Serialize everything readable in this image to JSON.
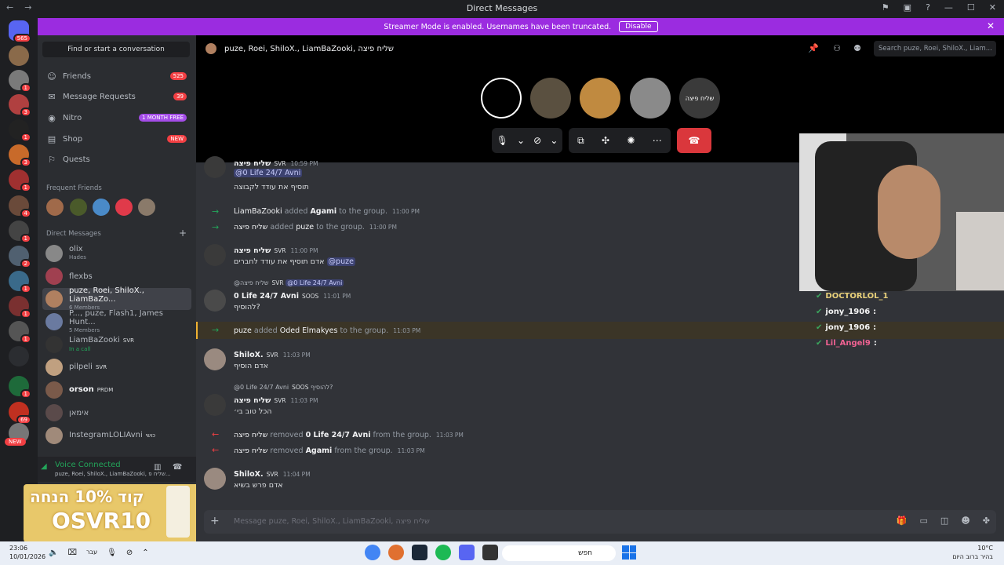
{
  "window": {
    "title": "Direct Messages"
  },
  "banner": {
    "text": "Streamer Mode is enabled. Usernames have been truncated.",
    "button": "Disable"
  },
  "servers": {
    "home_badge": "565",
    "new_label": "NEW"
  },
  "sidebar": {
    "find": "Find or start a conversation",
    "nav": [
      {
        "label": "Friends",
        "badge": "525"
      },
      {
        "label": "Message Requests",
        "badge": "39"
      },
      {
        "label": "Nitro",
        "badge": "1 MONTH FREE"
      },
      {
        "label": "Shop",
        "badge": "NEW"
      },
      {
        "label": "Quests",
        "badge": ""
      }
    ],
    "frequent_title": "Frequent Friends",
    "dm_title": "Direct Messages",
    "dms": [
      {
        "name": "olix",
        "sub": "Hades",
        "tag": ""
      },
      {
        "name": "flexbs",
        "sub": "",
        "tag": ""
      },
      {
        "name": "puze, Roei, ShiloX., LiamBaZo...",
        "sub": "6 Members",
        "tag": ""
      },
      {
        "name": "P..., puze, Flash1, James Hunt...",
        "sub": "5 Members",
        "tag": ""
      },
      {
        "name": "LiamBaZooki",
        "sub": "In a call",
        "tag": "SVR"
      },
      {
        "name": "pilpeli",
        "sub": "",
        "tag": "SVR"
      },
      {
        "name": "orson",
        "sub": "",
        "tag": "PRDM"
      },
      {
        "name": "אימאן",
        "sub": "",
        "tag": ""
      },
      {
        "name": "InstegramLOLIAvni",
        "sub": "",
        "tag": "כושי"
      }
    ],
    "voice": {
      "status": "Voice Connected",
      "channel": "puze, Roei, ShiloX., LiamBaZooki, שליח פ..."
    },
    "promo": {
      "line1": "קוד 10% הנחה",
      "line2": "OSVR10"
    }
  },
  "channel": {
    "title": "puze, Roei, ShiloX., LiamBaZooki, שליח פיצה",
    "search_placeholder": "Search puze, Roei, ShiloX., Liam..."
  },
  "call": {
    "badge": "שליח פיצה"
  },
  "messages": {
    "m1": {
      "author": "שליח פיצה",
      "tag": "SVR",
      "time": "10:59 PM",
      "mention": "@0 Life 24/7 Avni",
      "text": "תוסיף את עודד לקבוצה"
    },
    "s1": {
      "actor": "LiamBaZooki",
      "verb": "added",
      "target": "Agami",
      "rest": "to the group.",
      "time": "11:00 PM"
    },
    "s2": {
      "actor": "שליח פיצה",
      "verb": "added",
      "target": "puze",
      "rest": "to the group.",
      "time": "11:00 PM"
    },
    "m2": {
      "author": "שליח פיצה",
      "tag": "SVR",
      "time": "11:00 PM",
      "text": "אדם תוסיף את עודד לחברים",
      "mention": "@puze"
    },
    "m3": {
      "reply_author": "@שליח פיצה",
      "reply_tag": "SVR",
      "reply_mention": "@0 Life 24/7 Avni",
      "author": "0 Life 24/7 Avni",
      "tag": "SOOS",
      "time": "11:01 PM",
      "text": "להוסיף?"
    },
    "s3": {
      "actor": "puze",
      "verb": "added",
      "target": "Oded Elmakyes",
      "rest": "to the group.",
      "time": "11:03 PM"
    },
    "m4": {
      "author": "ShiloX.",
      "tag": "SVR",
      "time": "11:03 PM",
      "text": "אדם הוסיף"
    },
    "m5": {
      "reply_author": "@0 Life 24/7 Avni",
      "reply_tag": "SOOS",
      "reply_text": "להוסיף?",
      "author": "שליח פיצה",
      "tag": "SVR",
      "time": "11:03 PM",
      "text": "הכל טוב בי׳"
    },
    "s4": {
      "actor": "שליח פיצה",
      "verb": "removed",
      "target": "0 Life 24/7 Avni",
      "rest": "from the group.",
      "time": "11:03 PM"
    },
    "s5": {
      "actor": "שליח פיצה",
      "verb": "removed",
      "target": "Agami",
      "rest": "from the group.",
      "time": "11:03 PM"
    },
    "m6": {
      "author": "ShiloX.",
      "tag": "SVR",
      "time": "11:04 PM",
      "text": "אדם פרש בשיא"
    }
  },
  "composer": {
    "placeholder": "Message puze, Roei, ShiloX., LiamBaZooki, שליח פיצה"
  },
  "stream_chat": [
    {
      "user": "DOCTORLOL_1",
      "color": "#e8d07a"
    },
    {
      "user": "jony_1906",
      "color": "#e8d07a"
    },
    {
      "user": "jony_1906",
      "color": "#e8d07a"
    },
    {
      "user": "Lil_Angel9",
      "color": "#f06292"
    }
  ],
  "taskbar": {
    "time": "23:06",
    "date": "10/01/2026",
    "lang": "עבר",
    "search": "חפש",
    "temp": "10°C",
    "weather": "בהיר ברוב היום"
  },
  "colors": {
    "accent": "#9b2ce0",
    "online": "#23a55a",
    "danger": "#da373c"
  }
}
